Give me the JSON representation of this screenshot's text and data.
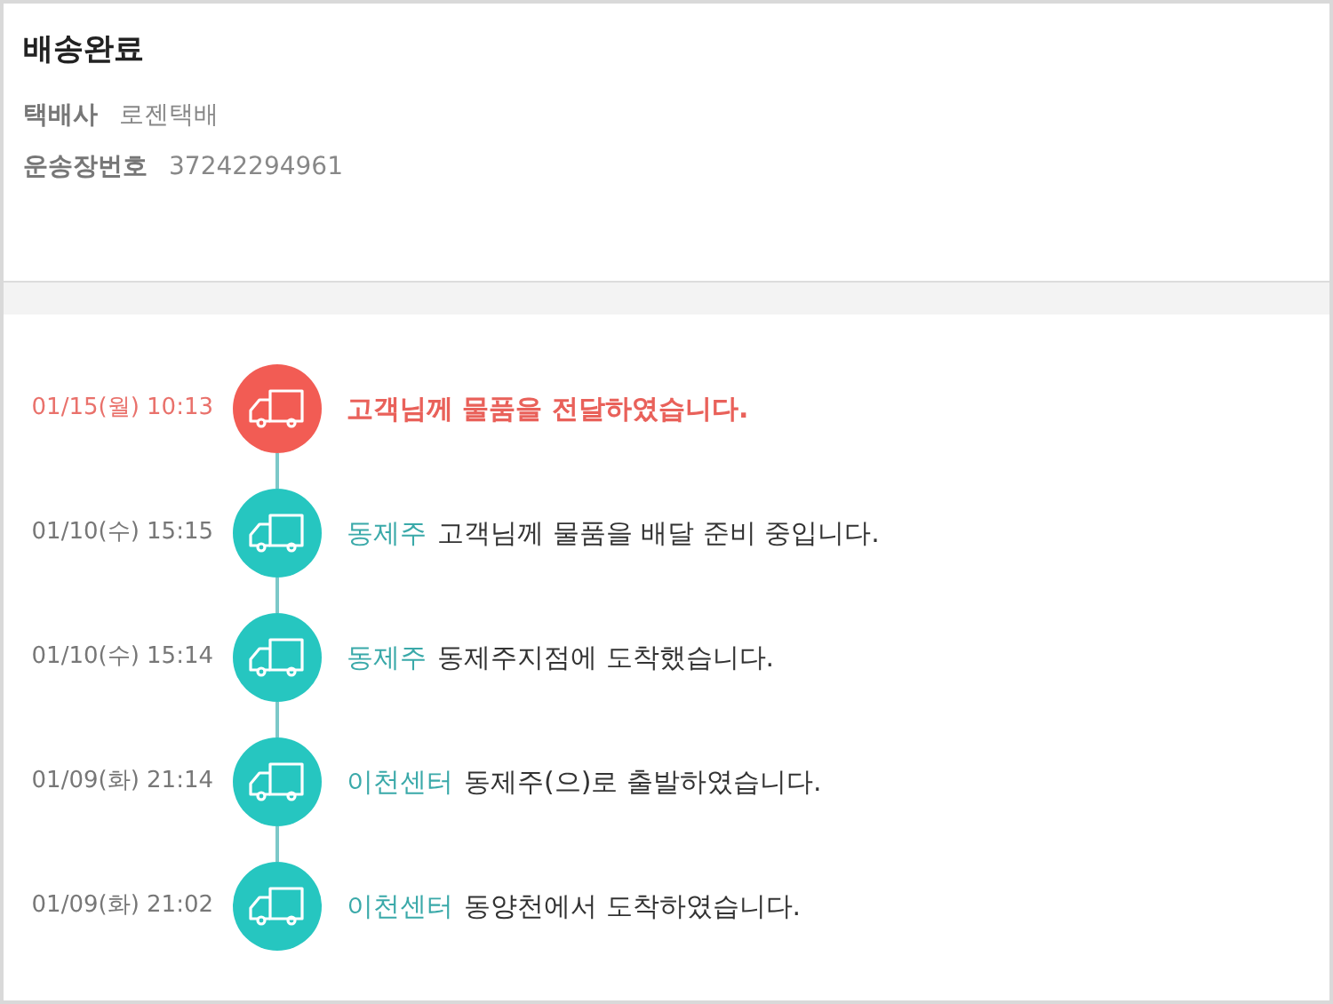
{
  "status_title": "배송완료",
  "info": [
    {
      "label": "택배사",
      "value": "로젠택배"
    },
    {
      "label": "운송장번호",
      "value": "37242294961"
    }
  ],
  "events": [
    {
      "time": "01/15(월) 10:13",
      "current": true,
      "message": "고객님께 물품을 전달하였습니다."
    },
    {
      "time": "01/10(수) 15:15",
      "current": false,
      "location": "동제주",
      "message": "고객님께 물품을 배달 준비 중입니다."
    },
    {
      "time": "01/10(수) 15:14",
      "current": false,
      "location": "동제주",
      "message": "동제주지점에 도착했습니다."
    },
    {
      "time": "01/09(화) 21:14",
      "current": false,
      "location": "이천센터",
      "message": "동제주(으)로 출발하였습니다."
    },
    {
      "time": "01/09(화) 21:02",
      "current": false,
      "location": "이천센터",
      "message": "동양천에서 도착하였습니다."
    }
  ]
}
